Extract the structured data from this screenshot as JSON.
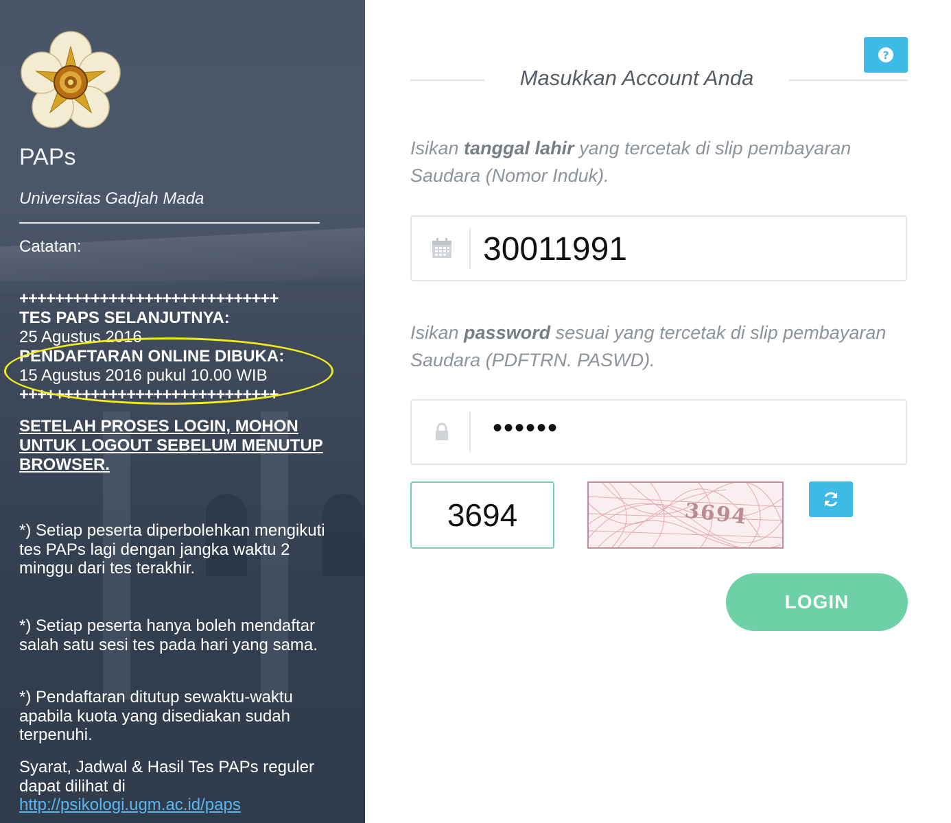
{
  "sidebar": {
    "logo_icon": "ugm-emblem-icon",
    "app_name": "PAPs",
    "university": "Universitas Gadjah Mada",
    "notes_label": "Catatan:",
    "plus_line": "+++++++++++++++++++++++++++++",
    "next_test_label": "TES PAPS SELANJUTNYA:",
    "next_test_date": "25 Agustus 2016",
    "registration_label": "PENDAFTARAN ONLINE DIBUKA:",
    "registration_date": "15 Agustus 2016 pukul 10.00 WIB",
    "plus_line_2": "+++++++++++++++++++++++++++++",
    "logout_warning": "SETELAH PROSES LOGIN, MOHON UNTUK LOGOUT SEBELUM MENUTUP BROWSER.",
    "note_1": "*) Setiap peserta diperbolehkan mengikuti tes PAPs lagi dengan jangka waktu 2 minggu dari tes terakhir.",
    "note_2": "*) Setiap peserta hanya boleh mendaftar salah satu sesi tes pada hari yang sama.",
    "note_3": "*) Pendaftaran ditutup sewaktu-waktu apabila kuota yang disediakan sudah terpenuhi.",
    "info_text": "Syarat, Jadwal & Hasil Tes PAPs reguler dapat dilihat di",
    "info_link": "http://psikologi.ugm.ac.id/paps"
  },
  "form": {
    "help_icon": "question-circle-icon",
    "heading": "Masukkan Account Anda",
    "dob_instruction_pre": "Isikan ",
    "dob_instruction_bold": "tanggal lahir",
    "dob_instruction_post": " yang tercetak di slip pembayaran Saudara (Nomor Induk).",
    "dob_icon": "calendar-icon",
    "dob_value": "30011991",
    "pw_instruction_pre": "Isikan ",
    "pw_instruction_bold": "password",
    "pw_instruction_post": " sesuai yang tercetak di slip pembayaran Saudara (PDFTRN. PASWD).",
    "pw_icon": "lock-icon",
    "pw_value": "••••••",
    "captcha_value": "3694",
    "captcha_image_text": "3694",
    "refresh_icon": "refresh-icon",
    "login_label": "LOGIN"
  },
  "colors": {
    "accent_blue": "#3dbbe6",
    "login_green": "#6ed0a7",
    "highlight_yellow": "#f2ec1a"
  }
}
